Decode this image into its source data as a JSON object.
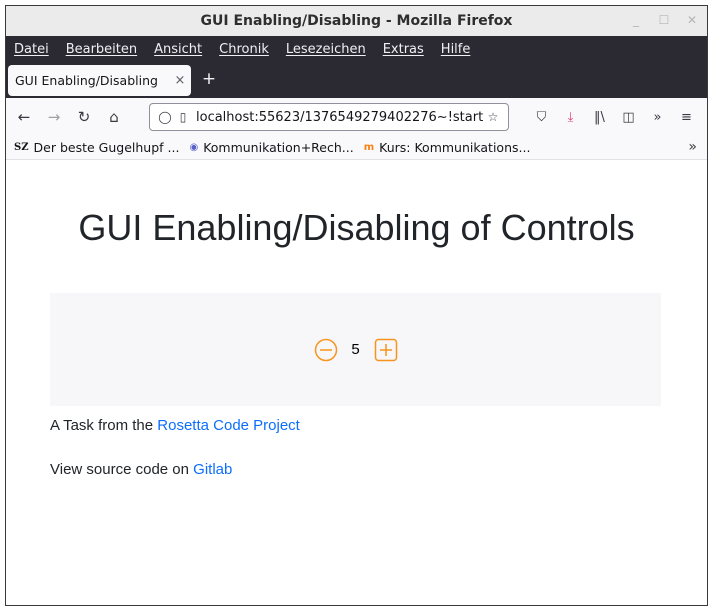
{
  "window": {
    "title": "GUI Enabling/Disabling - Mozilla Firefox",
    "controls": [
      "minimize-icon",
      "maximize-icon",
      "close-icon"
    ]
  },
  "menubar": {
    "items": [
      {
        "label": "Datei"
      },
      {
        "label": "Bearbeiten"
      },
      {
        "label": "Ansicht"
      },
      {
        "label": "Chronik"
      },
      {
        "label": "Lesezeichen"
      },
      {
        "label": "Extras"
      },
      {
        "label": "Hilfe"
      }
    ]
  },
  "tab": {
    "label": "GUI Enabling/Disabling",
    "close": "×",
    "new_tab": "+"
  },
  "navbar": {
    "url_main": "localhost:55623/1376549279402276~!start?",
    "url_fade": "!",
    "icons": [
      "back-icon",
      "forward-icon",
      "reload-icon",
      "home-icon",
      "shield-icon",
      "page-icon",
      "star-icon",
      "pocket-icon",
      "download-icon",
      "library-icon",
      "sidebar-icon",
      "overflow-icon",
      "menu-icon"
    ]
  },
  "bookmarks": {
    "items": [
      {
        "icon": "SZ",
        "label": "Der beste Gugelhupf ..."
      },
      {
        "icon": "globe-icon",
        "label": "Kommunikation+Rech..."
      },
      {
        "icon": "m",
        "label": "Kurs: Kommunikations..."
      }
    ],
    "more": "»"
  },
  "page": {
    "heading": "GUI Enabling/Disabling of Controls",
    "value": "5",
    "task_prefix": "A Task from the ",
    "task_link": "Rosetta Code Project",
    "source_prefix": "View source code on ",
    "source_link": "Gitlab"
  },
  "colors": {
    "accent_orange": "#f7941d",
    "link": "#0d6efd",
    "browser_dark": "#2b2a33"
  }
}
